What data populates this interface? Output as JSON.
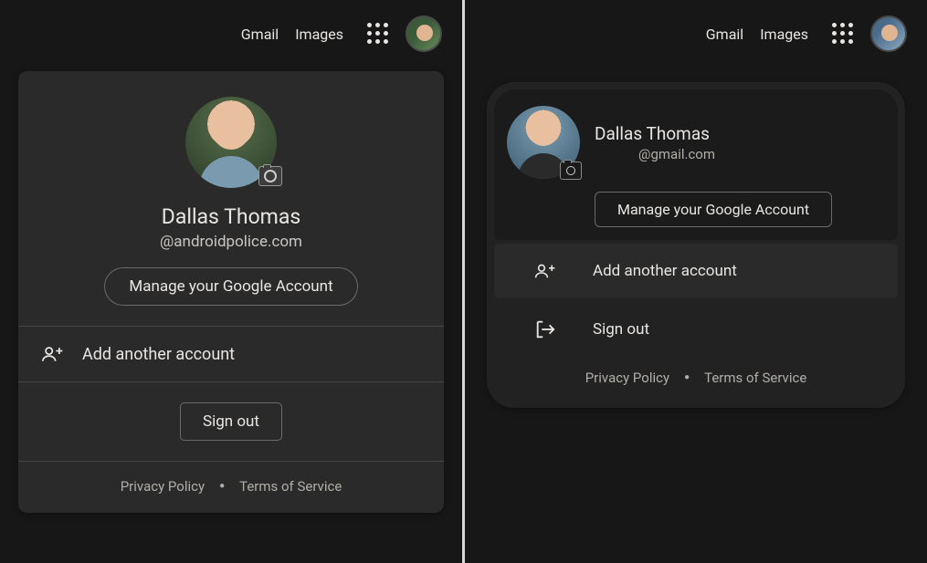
{
  "topbar": {
    "gmail": "Gmail",
    "images": "Images"
  },
  "left": {
    "name": "Dallas Thomas",
    "email": "@androidpolice.com",
    "manage": "Manage your Google Account",
    "add_account": "Add another account",
    "sign_out": "Sign out",
    "privacy": "Privacy Policy",
    "terms": "Terms of Service"
  },
  "right": {
    "name": "Dallas Thomas",
    "email": "@gmail.com",
    "manage": "Manage your Google Account",
    "add_account": "Add another account",
    "sign_out": "Sign out",
    "privacy": "Privacy Policy",
    "terms": "Terms of Service"
  }
}
